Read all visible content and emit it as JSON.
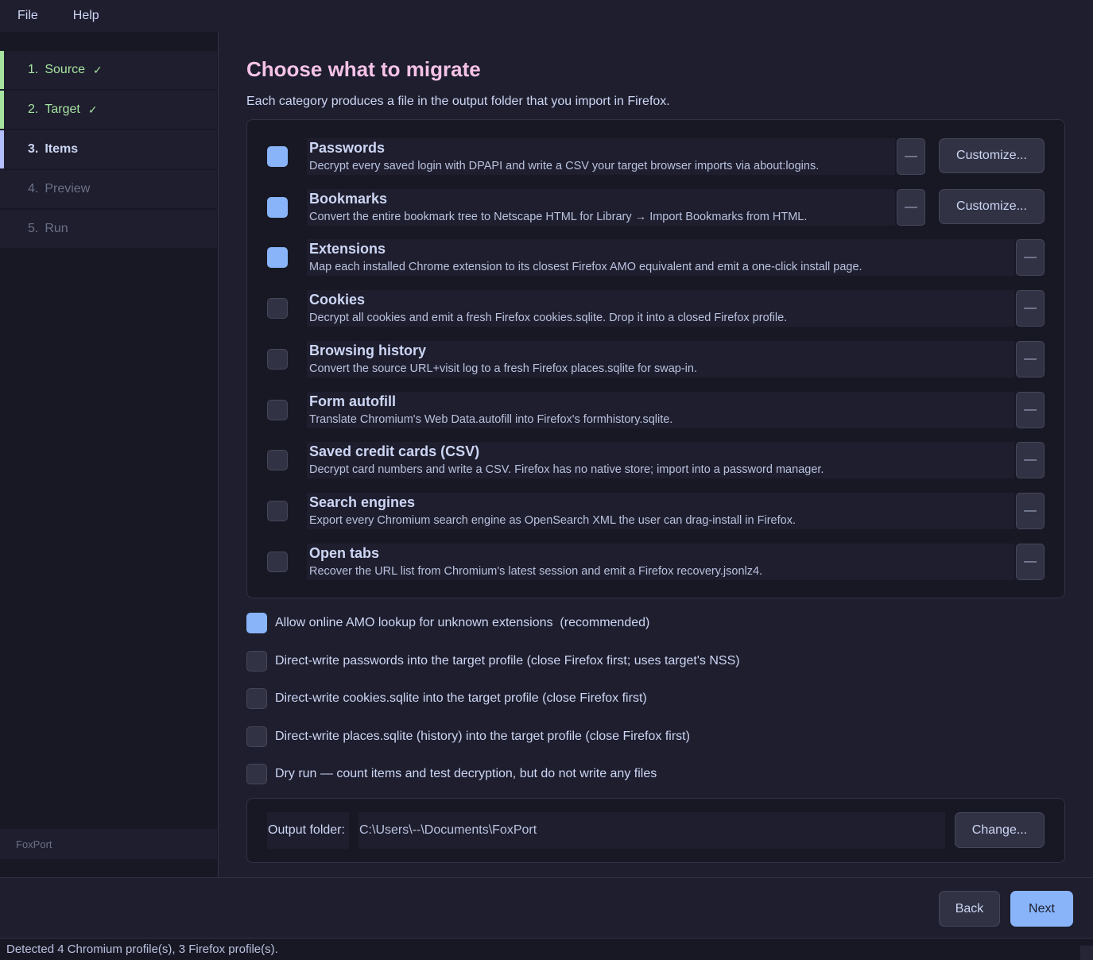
{
  "menubar": {
    "file": "File",
    "help": "Help"
  },
  "sidebar": {
    "steps": [
      {
        "num": "1.",
        "label": "Source",
        "check": "✓",
        "state": "done"
      },
      {
        "num": "2.",
        "label": "Target",
        "check": "✓",
        "state": "done"
      },
      {
        "num": "3.",
        "label": "Items",
        "check": "",
        "state": "active"
      },
      {
        "num": "4.",
        "label": "Preview",
        "check": "",
        "state": "pending"
      },
      {
        "num": "5.",
        "label": "Run",
        "check": "",
        "state": "pending"
      }
    ],
    "brand": "FoxPort"
  },
  "main": {
    "title": "Choose what to migrate",
    "subtitle": "Each category produces a file in the output folder that you import in Firefox.",
    "items": [
      {
        "name": "Passwords",
        "desc": "Decrypt every saved login with DPAPI and write a CSV your target browser imports via about:logins.",
        "checked": true,
        "dash": "—",
        "customize": "Customize..."
      },
      {
        "name": "Bookmarks",
        "desc": "Convert the entire bookmark tree to Netscape HTML for Library → Import Bookmarks from HTML.",
        "checked": true,
        "dash": "—",
        "customize": "Customize..."
      },
      {
        "name": "Extensions",
        "desc": "Map each installed Chrome extension to its closest Firefox AMO equivalent and emit a one-click install page.",
        "checked": true,
        "dash": "—"
      },
      {
        "name": "Cookies",
        "desc": "Decrypt all cookies and emit a fresh Firefox cookies.sqlite. Drop it into a closed Firefox profile.",
        "checked": false,
        "dash": "—"
      },
      {
        "name": "Browsing history",
        "desc": "Convert the source URL+visit log to a fresh Firefox places.sqlite for swap-in.",
        "checked": false,
        "dash": "—"
      },
      {
        "name": "Form autofill",
        "desc": "Translate Chromium's Web Data.autofill into Firefox's formhistory.sqlite.",
        "checked": false,
        "dash": "—"
      },
      {
        "name": "Saved credit cards (CSV)",
        "desc": "Decrypt card numbers and write a CSV. Firefox has no native store; import into a password manager.",
        "checked": false,
        "dash": "—"
      },
      {
        "name": "Search engines",
        "desc": "Export every Chromium search engine as OpenSearch XML the user can drag-install in Firefox.",
        "checked": false,
        "dash": "—"
      },
      {
        "name": "Open tabs",
        "desc": "Recover the URL list from Chromium's latest session and emit a Firefox recovery.jsonlz4.",
        "checked": false,
        "dash": "—"
      }
    ],
    "options": [
      {
        "label": "Allow online AMO lookup for unknown extensions  (recommended)",
        "checked": true
      },
      {
        "label": "Direct-write passwords into the target profile (close Firefox first; uses target's NSS)",
        "checked": false
      },
      {
        "label": "Direct-write cookies.sqlite into the target profile (close Firefox first)",
        "checked": false
      },
      {
        "label": "Direct-write places.sqlite (history) into the target profile (close Firefox first)",
        "checked": false
      },
      {
        "label": "Dry run — count items and test decryption, but do not write any files",
        "checked": false
      }
    ],
    "output": {
      "label": "Output folder:",
      "value": "C:\\Users\\--\\Documents\\FoxPort",
      "change": "Change..."
    }
  },
  "nav": {
    "back": "Back",
    "next": "Next"
  },
  "status": "Detected 4 Chromium profile(s), 3 Firefox profile(s).",
  "colors": {
    "accent": "#89b4fa",
    "title": "#f5c2e7",
    "done": "#a6e3a1",
    "active_bar": "#b4befe",
    "background": "#1e1e2e"
  }
}
